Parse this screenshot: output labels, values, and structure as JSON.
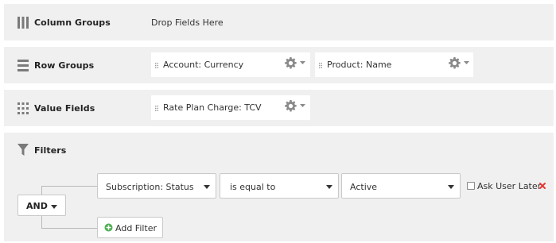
{
  "column_groups": {
    "title": "Column Groups",
    "icon": "columns-icon",
    "drop_placeholder": "Drop Fields Here"
  },
  "row_groups": {
    "title": "Row Groups",
    "icon": "rows-icon",
    "fields": [
      {
        "label": "Account: Currency"
      },
      {
        "label": "Product: Name"
      }
    ]
  },
  "value_fields": {
    "title": "Value Fields",
    "icon": "grid-icon",
    "fields": [
      {
        "label": "Rate Plan Charge: TCV"
      }
    ]
  },
  "filters": {
    "title": "Filters",
    "icon": "funnel-icon",
    "logic_operator": "AND",
    "rows": [
      {
        "field": "Subscription: Status",
        "operator": "is equal to",
        "value": "Active",
        "ask_user_later_label": "Ask User Later",
        "ask_user_later_checked": false
      }
    ],
    "add_filter_label": "Add Filter"
  },
  "colors": {
    "panel_bg": "#f0f0f0",
    "chip_bg": "#ffffff",
    "add_icon": "#4caf50",
    "remove_icon": "#e53935",
    "icon_gray": "#7a7a7a"
  }
}
